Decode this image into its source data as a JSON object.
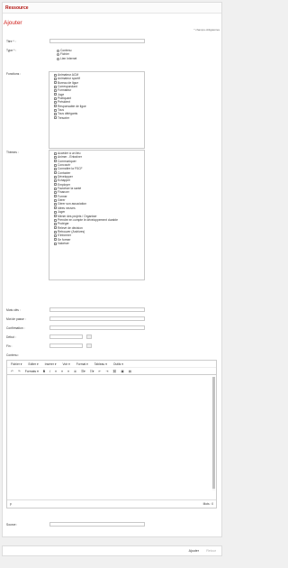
{
  "header": {
    "title": "Ressource"
  },
  "form": {
    "title": "Ajouter",
    "required_note": "* champs obligatoires",
    "labels": {
      "titre": "Titre * :",
      "type": "Type * :",
      "fonctions": "Fonctions :",
      "themes": "Thèmes :",
      "mots_cles": "Mots clés :",
      "mot_de_passe": "Mot de passe :",
      "confirmation": "Confirmation :",
      "debut": "Début :",
      "fin": "Fin :",
      "contenu": "Contenu :",
      "source": "Source :"
    },
    "type_options": [
      "Contenu",
      "Fichier",
      "Lien Internet"
    ],
    "fonctions": [
      "Animateur ACM",
      "Animateur sportif",
      "Bureau de ligue",
      "Correspondant",
      "Formateur",
      "Juge",
      "Pratiquant",
      "Président",
      "Responsable de ligue",
      "Tous",
      "Tous délégants",
      "Trésorier"
    ],
    "themes": [
      "Accéder à un lieu",
      "Animer - Entraîner",
      "Communiquer",
      "Concourir",
      "Connaître la FSCF",
      "Contacter",
      "Développer",
      "Echapper",
      "Employer",
      "Favoriser la santé",
      "Financer",
      "Former",
      "Gérer",
      "Gérer son association",
      "Idées neuves",
      "Juger",
      "Mener des projets / Organiser",
      "Prendre en compte le développement durable",
      "Protéger",
      "Relevé de décision",
      "Retrouver (Archives)",
      "S'informer",
      "Se former",
      "Valoriser"
    ]
  },
  "editor": {
    "menu": [
      "Fichier ▾",
      "Editer ▾",
      "Insérer ▾",
      "Voir ▾",
      "Format ▾",
      "Tableau ▾",
      "Outils ▾"
    ],
    "formats_label": "Formats ▾",
    "status_path": "p",
    "word_count": "Mots : 0"
  },
  "footer": {
    "add_label": "Ajouter",
    "back_label": "Retour"
  }
}
